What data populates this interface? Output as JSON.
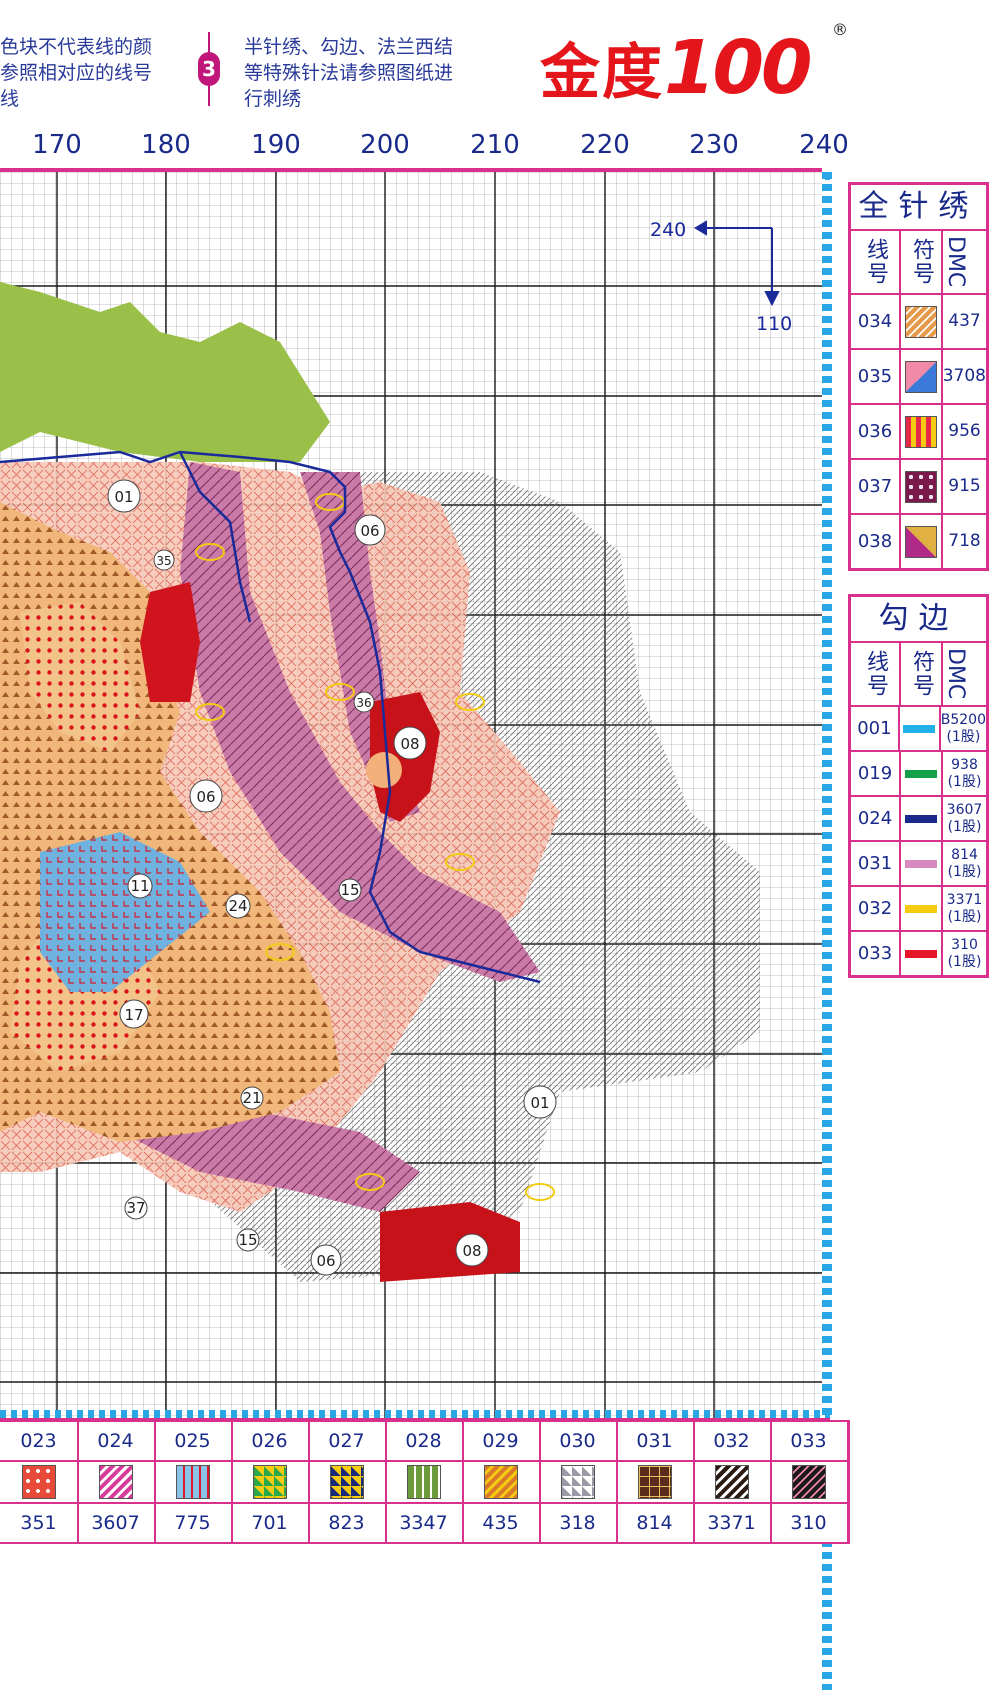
{
  "header": {
    "note_left": [
      "色块不代表线的颜",
      "参照相对应的线号",
      "线"
    ],
    "step_number": "3",
    "note_right": [
      "半针绣、勾边、法兰西结",
      "等特殊针法请参照图纸进",
      "行刺绣"
    ],
    "logo_cn": "金度",
    "logo_num": "100",
    "registered": "®"
  },
  "axis": {
    "labels": [
      "170",
      "180",
      "190",
      "200",
      "210",
      "220",
      "230",
      "240"
    ]
  },
  "chart": {
    "arrow_x_label": "240",
    "arrow_y_label": "110",
    "region_labels": [
      "01",
      "06",
      "08",
      "06",
      "24",
      "11",
      "17",
      "21",
      "37",
      "15",
      "06",
      "08",
      "01",
      "15",
      "35",
      "36"
    ]
  },
  "full_stitch": {
    "title": "全针绣",
    "col_code": "线号",
    "col_symbol": "符号",
    "col_dmc": "DMC",
    "rows": [
      {
        "code": "034",
        "dmc": "437",
        "color": "#e89a4a",
        "icon": "zigzag-icon"
      },
      {
        "code": "035",
        "dmc": "3708",
        "color": "#f08aa8",
        "icon": "triangle-blue-icon"
      },
      {
        "code": "036",
        "dmc": "956",
        "color": "#e8284a",
        "icon": "arrow-up-icon"
      },
      {
        "code": "037",
        "dmc": "915",
        "color": "#7a1a4a",
        "icon": "diamond-icon"
      },
      {
        "code": "038",
        "dmc": "718",
        "color": "#b02a8a",
        "icon": "triangle-pattern-icon"
      }
    ]
  },
  "backstitch": {
    "title": "勾边",
    "col_code": "线号",
    "col_symbol": "符号",
    "col_dmc": "DMC",
    "rows": [
      {
        "code": "001",
        "dmc": "B5200",
        "strand": "(1股)",
        "color": "#22b0e6"
      },
      {
        "code": "019",
        "dmc": "938",
        "strand": "(1股)",
        "color": "#12a04a"
      },
      {
        "code": "024",
        "dmc": "3607",
        "strand": "(1股)",
        "color": "#1a2a8a"
      },
      {
        "code": "031",
        "dmc": "814",
        "strand": "(1股)",
        "color": "#d88ac0"
      },
      {
        "code": "032",
        "dmc": "3371",
        "strand": "(1股)",
        "color": "#f6cc12"
      },
      {
        "code": "033",
        "dmc": "310",
        "strand": "(1股)",
        "color": "#e6162a"
      }
    ]
  },
  "bottom_legend": [
    {
      "code": "023",
      "dmc": "351",
      "color": "#e84a3a",
      "icon": "dots-icon"
    },
    {
      "code": "024",
      "dmc": "3607",
      "color": "#d83a9a",
      "icon": "zigzag-icon"
    },
    {
      "code": "025",
      "dmc": "775",
      "color": "#8ac4e8",
      "icon": "letter-l-icon"
    },
    {
      "code": "026",
      "dmc": "701",
      "color": "#2aa84a",
      "icon": "triangle-icon"
    },
    {
      "code": "027",
      "dmc": "823",
      "color": "#1a2a7a",
      "icon": "triangle-icon"
    },
    {
      "code": "028",
      "dmc": "3347",
      "color": "#6a9a3a",
      "icon": "arrow-up-icon"
    },
    {
      "code": "029",
      "dmc": "435",
      "color": "#d87a2a",
      "icon": "zigzag-icon"
    },
    {
      "code": "030",
      "dmc": "318",
      "color": "#9a9aa6",
      "icon": "triangle-icon"
    },
    {
      "code": "031",
      "dmc": "814",
      "color": "#5a2a1a",
      "icon": "grid-icon"
    },
    {
      "code": "032",
      "dmc": "3371",
      "color": "#2a1a12",
      "icon": "slash-icon"
    },
    {
      "code": "033",
      "dmc": "310",
      "color": "#1a1a1a",
      "icon": "zigzag-icon"
    }
  ]
}
